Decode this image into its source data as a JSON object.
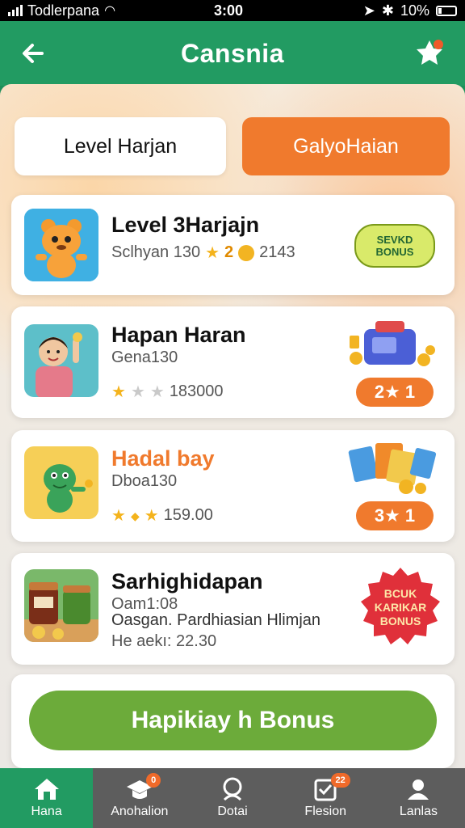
{
  "status_bar": {
    "carrier": "Todlerpana",
    "time": "3:00",
    "battery": "10%"
  },
  "header": {
    "title": "Cansnia",
    "back_icon": "back-arrow-icon",
    "action_icon": "star-badge-icon"
  },
  "tabs": [
    {
      "label": "Level Harjan",
      "active": false
    },
    {
      "label": "GalyoHaian",
      "active": true
    }
  ],
  "cards": [
    {
      "title": "Level 3Harjajn",
      "subtitle": "",
      "stats": "Sclhyan 130",
      "rating_text": "2",
      "extra": "2143",
      "badge": "SEVKD BONUS",
      "title_color": "#111111",
      "thumb": "cartoon-bear"
    },
    {
      "title": "Hapan Haran",
      "subtitle": "Gena130",
      "rating": 1,
      "extra": "183000",
      "pill": "2★ 1",
      "title_color": "#111111",
      "thumb": "child-photo"
    },
    {
      "title": "Hadal bay",
      "subtitle": "Dboa130",
      "rating": 2,
      "extra": "159.00",
      "pill": "3★ 1",
      "title_color": "#f07a2d",
      "thumb": "cartoon-dino"
    },
    {
      "title": "Sarhighidapan",
      "subtitle": "Oam1:08",
      "line2": "Oasgan. Pardhiasian Hlimjan",
      "line3": "He aekı: 22.30",
      "badge": "BCUK KARIKAR BONUS",
      "title_color": "#111111",
      "thumb": "jars-photo"
    }
  ],
  "cta": {
    "label": "Hapikiay h Bonus"
  },
  "bottom_nav": [
    {
      "label": "Hana",
      "icon": "home-icon",
      "active": true,
      "badge": ""
    },
    {
      "label": "Anohalion",
      "icon": "graduation-cap-icon",
      "active": false,
      "badge": "0"
    },
    {
      "label": "Dotai",
      "icon": "profile-chat-icon",
      "active": false,
      "badge": ""
    },
    {
      "label": "Flesion",
      "icon": "checklist-icon",
      "active": false,
      "badge": "22"
    },
    {
      "label": "Lanlas",
      "icon": "user-icon",
      "active": false,
      "badge": ""
    }
  ],
  "colors": {
    "primary_green": "#229b62",
    "accent_orange": "#f07a2d",
    "cta_green": "#6cab3a",
    "nav_gray": "#5d5d5d"
  }
}
